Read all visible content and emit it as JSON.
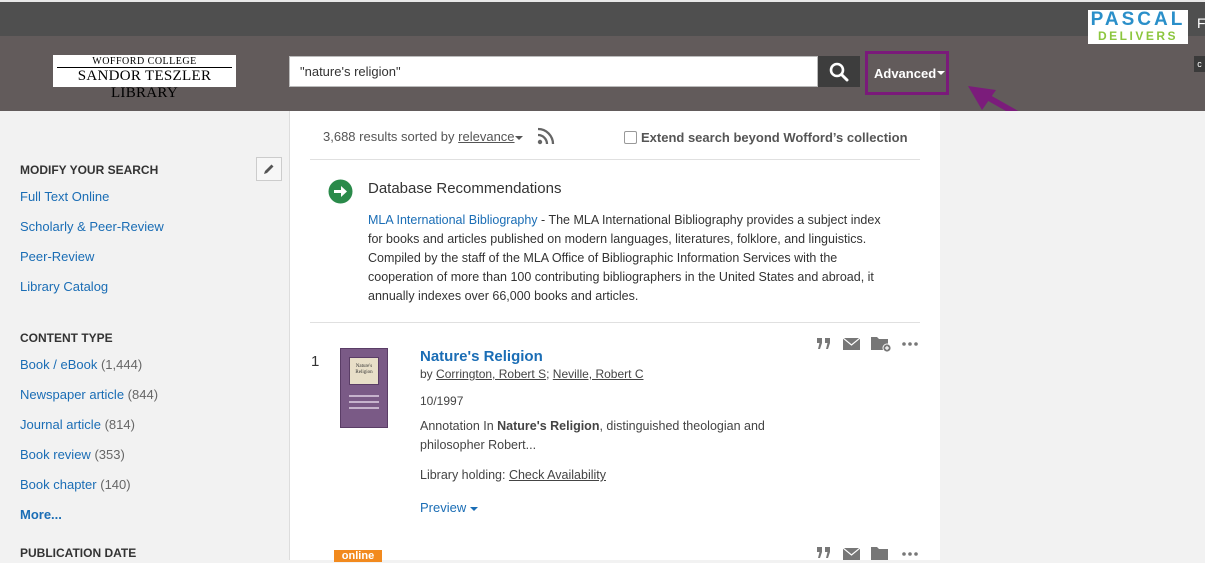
{
  "topbar": {
    "partner_line1": "PASCAL",
    "partner_line2": "DELIVERS",
    "partner_logo": "pascal-delivers-logo",
    "right_char": "F"
  },
  "header": {
    "logo_line1": "WOFFORD COLLEGE",
    "logo_line2": "SANDOR TESZLER LIBRARY",
    "search_value": "\"nature's religion\"",
    "advanced_label": "Advanced",
    "right_char": "c",
    "highlight_color": "#7a1a7a"
  },
  "sidebar": {
    "modify_heading": "MODIFY YOUR SEARCH",
    "modify_links": [
      "Full Text Online",
      "Scholarly & Peer-Review",
      "Peer-Review",
      "Library Catalog"
    ],
    "content_heading": "CONTENT TYPE",
    "content_types": [
      {
        "label": "Book / eBook",
        "count": "(1,444)"
      },
      {
        "label": "Newspaper article",
        "count": "(844)"
      },
      {
        "label": "Journal article",
        "count": "(814)"
      },
      {
        "label": "Book review",
        "count": "(353)"
      },
      {
        "label": "Book chapter",
        "count": "(140)"
      }
    ],
    "more_label": "More...",
    "pubdate_heading": "PUBLICATION DATE"
  },
  "results": {
    "count_text": "3,688 results sorted by",
    "sort_label": "relevance",
    "extend_label": "Extend search beyond Wofford’s collection"
  },
  "recommendation": {
    "heading": "Database Recommendations",
    "link": "MLA International Bibliography",
    "lines": [
      " - The MLA International Bibliography provides a subject index",
      "for books and articles published on modern languages, literatures, folklore, and linguistics.",
      "Compiled by the staff of the MLA Office of Bibliographic Information Services with the",
      "cooperation of more than 100 contributing bibliographers in the United States and abroad, it",
      "annually indexes over 66,000 books and articles."
    ]
  },
  "result1": {
    "number": "1",
    "title": "Nature's Religion",
    "by": "by",
    "author1": "Corrington, Robert S",
    "sep": ";",
    "author2": "Neville, Robert C",
    "date": "10/1997",
    "annot_pre": "Annotation In ",
    "annot_bold": "Nature's Religion",
    "annot_post": ", distinguished theologian and",
    "annot_line2": "philosopher Robert...",
    "holding_label": "Library holding:",
    "holding_link": "Check Availability",
    "preview_label": "Preview",
    "cover_line1": "Nature's",
    "cover_line2": "Religion"
  },
  "result2": {
    "badge": "online"
  }
}
